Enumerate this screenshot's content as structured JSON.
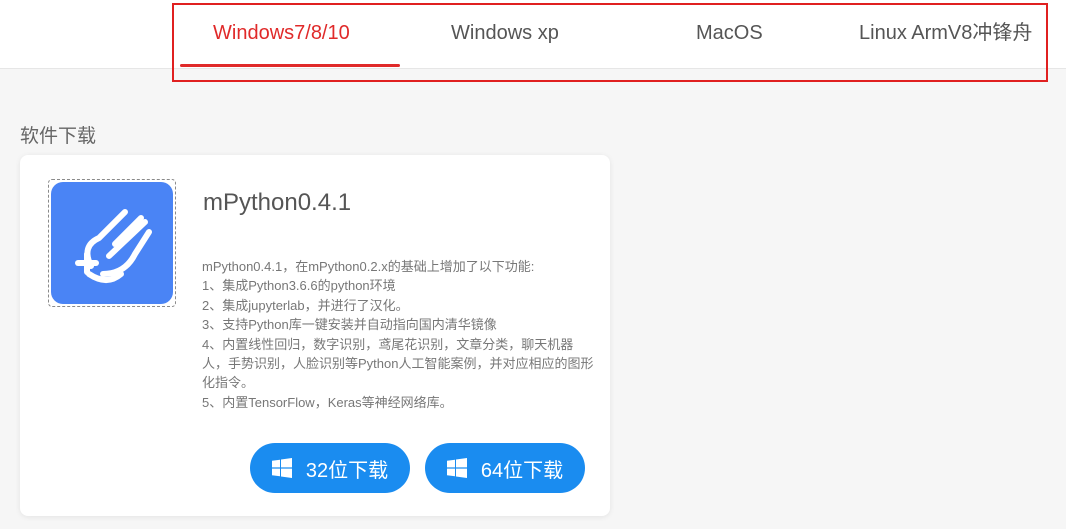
{
  "tabs": [
    {
      "label": "Windows7/8/10",
      "active": true
    },
    {
      "label": "Windows xp",
      "active": false
    },
    {
      "label": "MacOS",
      "active": false
    },
    {
      "label": "Linux ArmV8冲锋舟",
      "active": false
    }
  ],
  "section_title": "软件下载",
  "card": {
    "icon": "mpython-logo-icon",
    "title": "mPython0.4.1",
    "description_lines": [
      "mPython0.4.1，在mPython0.2.x的基础上增加了以下功能:",
      "1、集成Python3.6.6的python环境",
      "2、集成jupyterlab，并进行了汉化。",
      "3、支持Python库一键安装并自动指向国内清华镜像",
      "4、内置线性回归，数字识别，鸢尾花识别，文章分类，聊天机器人，手势识别，人脸识别等Python人工智能案例，并对应相应的图形化指令。",
      "5、内置TensorFlow，Keras等神经网络库。"
    ],
    "buttons": [
      {
        "label": "32位下载",
        "icon": "windows-icon"
      },
      {
        "label": "64位下载",
        "icon": "windows-icon"
      }
    ]
  },
  "colors": {
    "accent_red": "#e02a2a",
    "button_blue": "#1a8cf0",
    "icon_blue": "#4a84f5"
  }
}
